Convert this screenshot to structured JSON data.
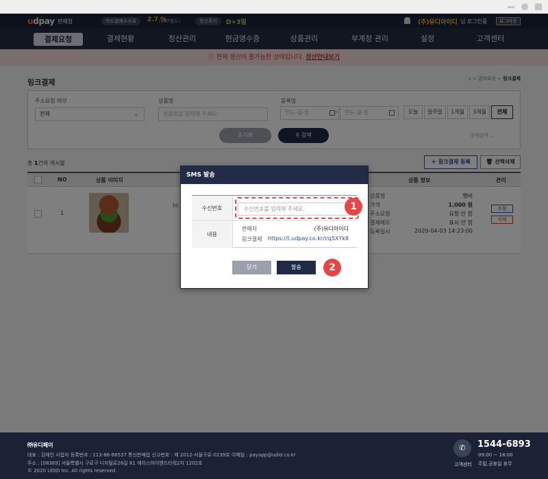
{
  "header": {
    "logo": "udpay",
    "logo_sub": "판매점",
    "card_fee_label": "카드결제수수료",
    "card_fee_rate": "2.7 %",
    "vat_note": "(VAT별도)",
    "cycle_label": "정산주기",
    "cycle_value": "D+3일",
    "company": "(주)유디아이디",
    "login_text": "님 로그인중",
    "logout": "로그아웃"
  },
  "nav": [
    "결제요청",
    "결제현황",
    "정산관리",
    "현금영수증",
    "상품관리",
    "부계정 관리",
    "설정",
    "고객센터"
  ],
  "notice": {
    "text": "현재 정산이 불가능한 상태입니다.",
    "link": "정산안내보기"
  },
  "page": {
    "title": "링크결제",
    "breadcrumb_1": "결제요청",
    "breadcrumb_2": "링크결제"
  },
  "filter": {
    "addr_label": "주소요청 여부",
    "addr_value": "전체",
    "product_label": "상품명",
    "product_placeholder": "상품명을 입력해 주세요.",
    "date_label": "등록일",
    "date_placeholder_from": "연도-월-일",
    "date_placeholder_to": "연도-월-일",
    "tilde": "~",
    "periods": [
      "오늘",
      "일주일",
      "1개월",
      "3개월",
      "전체"
    ],
    "reset": "초기화",
    "search": "검색",
    "detail": "상세검색"
  },
  "list": {
    "count_prefix": "총 ",
    "count": "1",
    "count_suffix": "건의 게시물",
    "register": "링크결제 등록",
    "delete_selected": "선택삭제",
    "columns": {
      "no": "NO",
      "image": "상품 이미지",
      "info": "상품 정보",
      "manage": "관리"
    },
    "row": {
      "no": "1",
      "link_partial": "ht",
      "labels": [
        "상품명",
        "가격",
        "주소요청",
        "결제메모",
        "등록일시"
      ],
      "values": [
        "햇바",
        "1,000 원",
        "요청 안 함",
        "표시 안 함",
        "2020-04-03 14:23:00"
      ],
      "edit": "수정",
      "delete": "삭제"
    }
  },
  "modal": {
    "title": "SMS 발송",
    "phone_label": "수신번호",
    "phone_placeholder": "수신번호를 입력해 주세요.",
    "content_label": "내용",
    "seller_label": "판매자",
    "seller_value": "(주)유디아이디",
    "link_label": "링크결제",
    "link_value": "https://t.udpay.co.kr/l/q5XYk8",
    "close": "닫기",
    "send": "발송",
    "badge_1": "1",
    "badge_2": "2"
  },
  "footer": {
    "company": "㈜유디페이",
    "line1": "대표 : 김재인 사업자 등록번호 : 113-86-66537 통신판매업 신고번호 : 제 2012-서울구로-0239호 이메일 : payapp@udid.co.kr",
    "line2": "주소 : [08389] 서울특별시 구로구 디지털로26길 61 에이스하이엔드타워2차 1202호",
    "line3": "© 2020 UDID Inc. All rights reserved.",
    "cs_label": "고객센터",
    "phone": "1544-6893",
    "hours": "09:00 ~ 18:00",
    "holiday": "주말,공휴일 휴무"
  },
  "colors": {
    "navy": "#1b2236",
    "accent_red": "#e84545",
    "link_blue": "#2c4a9a"
  }
}
